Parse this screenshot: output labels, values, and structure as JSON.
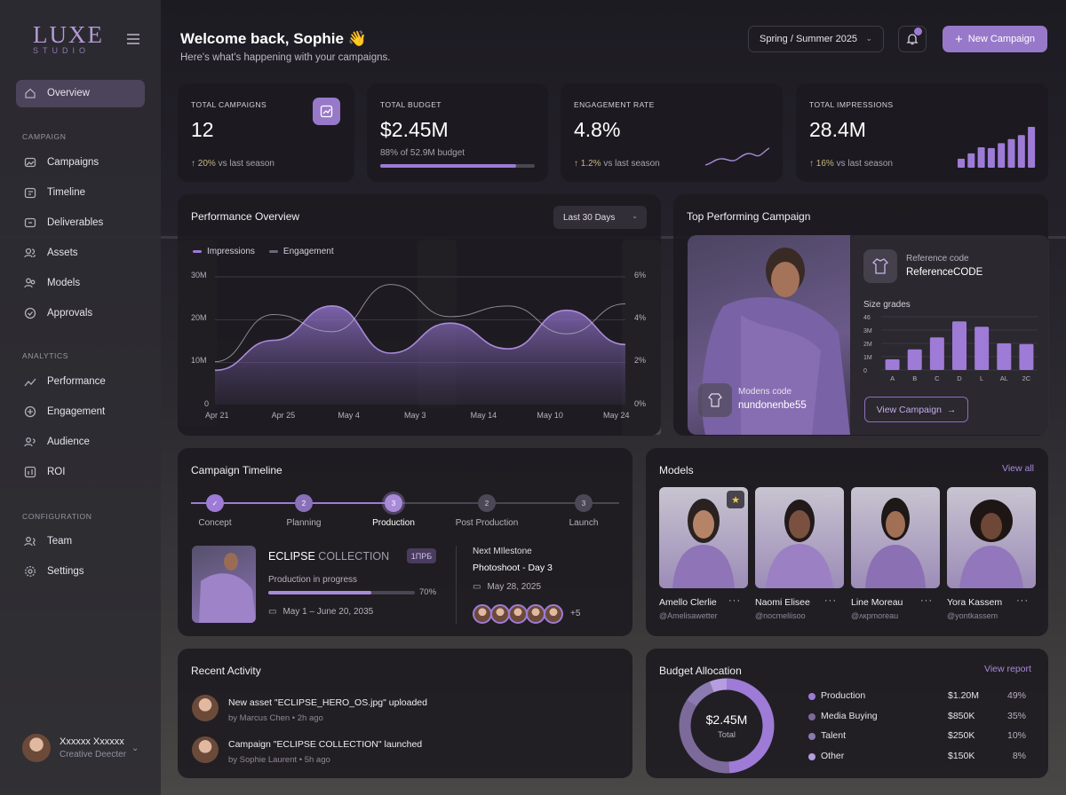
{
  "brand": {
    "name": "LUXE",
    "sub": "STUDIO"
  },
  "nav": {
    "overview": "Overview",
    "campaign_section": "CAMPAIGN",
    "campaign_items": [
      "Campaigns",
      "Timeline",
      "Deliverables",
      "Assets",
      "Models",
      "Approvals"
    ],
    "analytics_section": "ANALYTICS",
    "analytics_items": [
      "Performance",
      "Engagement",
      "Audience",
      "ROI"
    ],
    "config_section": "CONFIGURATION",
    "config_items": [
      "Team",
      "Settings"
    ]
  },
  "user": {
    "name": "Xxxxxx Xxxxxx",
    "role": "Creative Deecter"
  },
  "header": {
    "title": "Welcome back, Sophie 👋",
    "subtitle": "Here's what's happening with your campaigns.",
    "season": "Spring / Summer 2025",
    "new_campaign": "New Campaign"
  },
  "stats": [
    {
      "label": "TOTAL CAMPAIGNS",
      "value": "12",
      "trend": "20%",
      "trend_suffix": "vs last season"
    },
    {
      "label": "TOTAL BUDGET",
      "value": "$2.45M",
      "note": "88% of 52.9M budget",
      "progress": 0.88
    },
    {
      "label": "ENGAGEMENT RATE",
      "value": "4.8%",
      "trend": "1.2%",
      "trend_suffix": "vs last season"
    },
    {
      "label": "TOTAL IMPRESSIONS",
      "value": "28.4M",
      "trend": "16%",
      "trend_suffix": "vs last season"
    }
  ],
  "impressions_bars": [
    0.22,
    0.35,
    0.5,
    0.48,
    0.6,
    0.7,
    0.8,
    1.0
  ],
  "performance": {
    "title": "Performance Overview",
    "range": "Last 30 Days",
    "legend": [
      "Impressions",
      "Engagement"
    ]
  },
  "chart_data": {
    "type": "area",
    "x": [
      "Apr 21",
      "Apr 25",
      "May 4",
      "May 3",
      "May 14",
      "May 10",
      "May 24"
    ],
    "y_left_ticks": [
      "30M",
      "20M",
      "10M",
      "0"
    ],
    "y_right_ticks": [
      "6%",
      "4%",
      "2%",
      "0%"
    ],
    "ylim": [
      0,
      30
    ],
    "series": [
      {
        "name": "Impressions",
        "values": [
          8,
          15,
          23,
          12,
          19,
          13,
          22,
          14
        ]
      },
      {
        "name": "Engagement",
        "values": [
          2.0,
          4.2,
          3.4,
          5.6,
          4.1,
          4.6,
          3.3,
          4.7
        ]
      }
    ]
  },
  "top_campaign": {
    "title": "Top Performing Campaign",
    "ref_label": "Reference code",
    "ref_value": "ReferenceCODE",
    "size_title": "Size grades",
    "sizes": [
      "A",
      "B",
      "C",
      "D",
      "L",
      "AL",
      "2C"
    ],
    "size_values": [
      0.8,
      1.55,
      2.45,
      3.65,
      3.25,
      2.0,
      1.95
    ],
    "size_ticks": [
      "46",
      "3M",
      "2M",
      "1M",
      "0"
    ],
    "models_label": "Modens code",
    "models_value": "nundonenbe55",
    "view": "View Campaign"
  },
  "timeline": {
    "title": "Campaign Timeline",
    "steps": [
      {
        "label": "Concept",
        "n": "✓"
      },
      {
        "label": "Planning",
        "n": "2"
      },
      {
        "label": "Production",
        "n": "3"
      },
      {
        "label": "Post Production",
        "n": "2"
      },
      {
        "label": "Launch",
        "n": "3"
      }
    ],
    "collection_bold": "ECLIPSE",
    "collection_rest": "COLLECTION",
    "badge": "1ПРБ",
    "status": "Production in progress",
    "progress": 0.7,
    "progress_label": "70%",
    "dates": "May 1 – June 20, 2035",
    "milestone_label": "Next MIlestone",
    "milestone": "Photoshoot - Day 3",
    "milestone_date": "May 28, 2025",
    "more": "+5"
  },
  "models": {
    "title": "Models",
    "view_all": "View all",
    "items": [
      {
        "name": "Amello Clerlie",
        "handle": "@Amelisawetter"
      },
      {
        "name": "Naomi Elisee",
        "handle": "@nocmeliisoo"
      },
      {
        "name": "Line Moreau",
        "handle": "@ʌкpmoreau"
      },
      {
        "name": "Yora Kassem",
        "handle": "@yontkassem"
      }
    ]
  },
  "activity": {
    "title": "Recent Activity",
    "items": [
      {
        "text": "New asset \"ECLIPSE_HERO_OS.jpg\" uploaded",
        "meta": "by Marcus Chen • 2h ago"
      },
      {
        "text": "Campaign \"ECLIPSE COLLECTION\" launched",
        "meta": "by Sophie Laurent • 5h ago"
      }
    ]
  },
  "budget": {
    "title": "Budget Allocation",
    "view_report": "View report",
    "total_value": "$2.45M",
    "total_label": "Total",
    "rows": [
      {
        "name": "Production",
        "amount": "$1.20M",
        "pct": "49%",
        "color": "#9e7bd6",
        "share": 0.49
      },
      {
        "name": "Media Buying",
        "amount": "$850K",
        "pct": "35%",
        "color": "#7c6a9a",
        "share": 0.35
      },
      {
        "name": "Talent",
        "amount": "$250K",
        "pct": "10%",
        "color": "#8a7ab0",
        "share": 0.1
      },
      {
        "name": "Other",
        "amount": "$150K",
        "pct": "8%",
        "color": "#b59de0",
        "share": 0.06
      }
    ]
  }
}
